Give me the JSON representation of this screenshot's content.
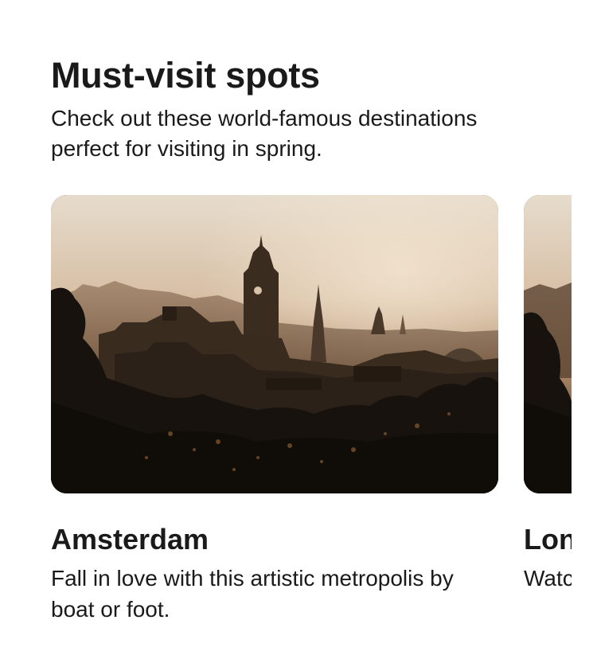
{
  "section": {
    "title": "Must-visit spots",
    "subtitle": "Check out these world-famous destinations perfect for visiting in spring."
  },
  "cards": [
    {
      "title": "Amsterdam",
      "description": "Fall in love with this artistic metropolis by boat or foot.",
      "image_icon": "city-skyline-photo"
    },
    {
      "title": "London",
      "description": "Watch the world go by from the riverbanks.",
      "image_icon": "city-skyline-photo"
    }
  ],
  "colors": {
    "sky_top": "#e4d8c8",
    "sky_glow": "#c9a582",
    "silhouette": "#1c1611",
    "text": "#1a1a1a"
  }
}
